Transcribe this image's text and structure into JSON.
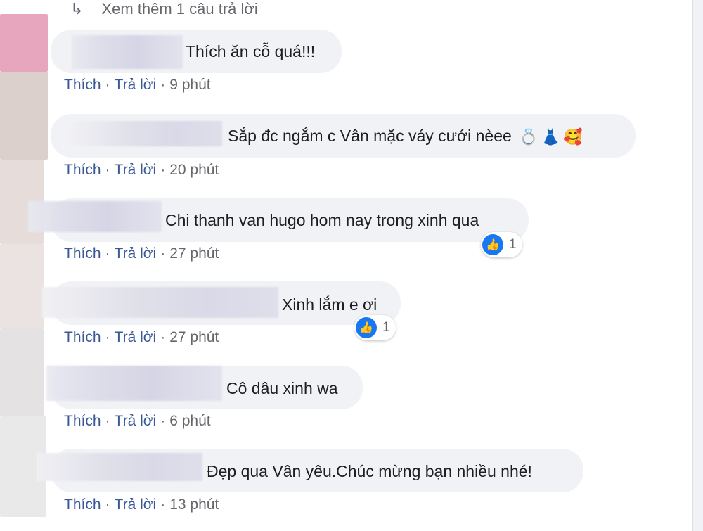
{
  "see_more": {
    "arrow": "↳",
    "label": "Xem thêm 1 câu trả lời"
  },
  "colors": {
    "bubble": "#f0f2f5",
    "action_link": "#385898",
    "meta_text": "#65676b",
    "like_blue": "#1877f2"
  },
  "action_labels": {
    "like": "Thích",
    "reply": "Trả lời",
    "separator": "·"
  },
  "comments": [
    {
      "text": "Thích ăn cỗ quá!!!",
      "time": "9 phút"
    },
    {
      "text": "Sắp đc ngắm c Vân mặc váy cưới nèee",
      "emojis": [
        "💍",
        "👗",
        "🥰"
      ],
      "time": "20 phút"
    },
    {
      "text": "Chi thanh van hugo hom nay trong xinh qua",
      "time": "27 phút",
      "likes": "1"
    },
    {
      "text": "Xinh lắm e ơi",
      "time": "27 phút",
      "likes": "1"
    },
    {
      "text": "Cô dâu xinh wa",
      "time": "6 phút"
    },
    {
      "text": "Đẹp qua Vân yêu.Chúc mừng bạn nhiều nhé!",
      "time": "13 phút"
    }
  ]
}
